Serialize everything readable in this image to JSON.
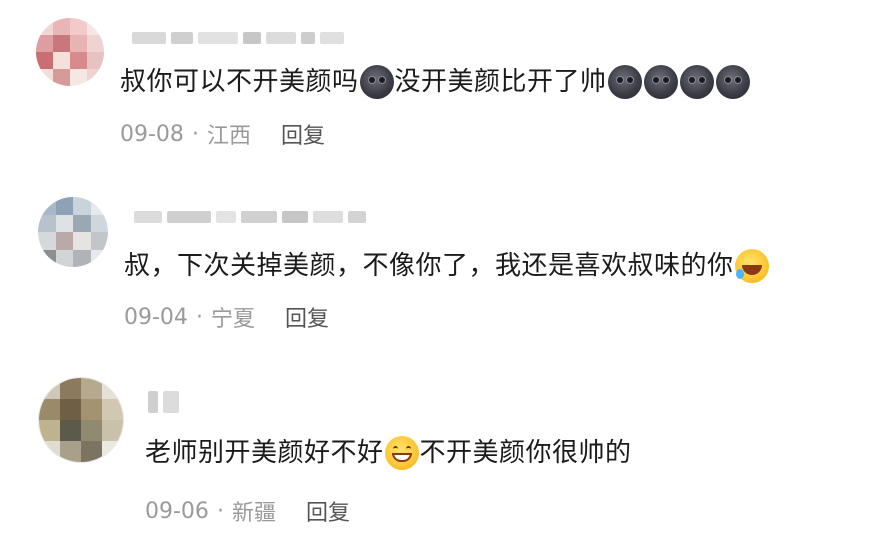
{
  "comments": [
    {
      "text_a": "叔你可以不开美颜吗",
      "text_b": "没开美颜比开了帅",
      "date": "09-08",
      "location": "江西",
      "reply_label": "回复"
    },
    {
      "text_a": "叔，下次关掉美颜，不像你了，我还是喜欢叔味的你",
      "date": "09-04",
      "location": "宁夏",
      "reply_label": "回复"
    },
    {
      "text_a": "老师别开美颜好不好",
      "text_b": "不开美颜你很帅的",
      "date": "09-06",
      "location": "新疆",
      "reply_label": "回复"
    }
  ],
  "meta_separator": "·",
  "icons": {
    "c1": "new-moon-face-emoji",
    "c2": "crying-laughing-emoji",
    "c3": "grinning-face-emoji"
  }
}
